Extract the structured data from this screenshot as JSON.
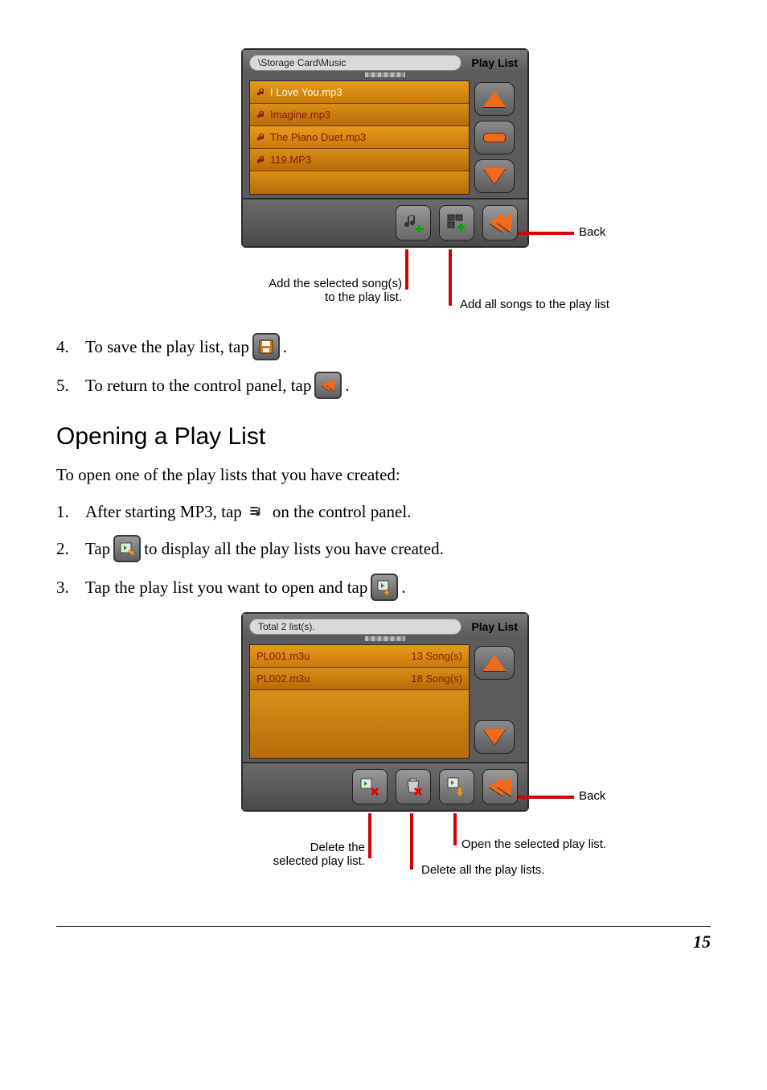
{
  "figure1": {
    "addr": "\\Storage Card\\Music",
    "title": "Play List",
    "songs": [
      {
        "name": "I Love You.mp3",
        "selected": true
      },
      {
        "name": "Imagine.mp3",
        "selected": false
      },
      {
        "name": "The Piano Duet.mp3",
        "selected": false
      },
      {
        "name": "119.MP3",
        "selected": false
      }
    ],
    "callouts": {
      "back": "Back",
      "add_selected_l1": "Add the selected song(s)",
      "add_selected_l2": "to the play list.",
      "add_all": "Add all songs to the play list"
    }
  },
  "step4": {
    "num": "4.",
    "pre": "To save the play list, tap",
    "post": "."
  },
  "step5": {
    "num": "5.",
    "pre": "To return to the control panel, tap",
    "post": "."
  },
  "heading": "Opening a Play List",
  "intro": "To open one of the play lists that you have created:",
  "ostep1": {
    "num": "1.",
    "pre": "After starting MP3, tap",
    "post": " on the control panel."
  },
  "ostep2": {
    "num": "2.",
    "pre": "Tap",
    "post": " to display all the play lists you have created."
  },
  "ostep3": {
    "num": "3.",
    "pre": "Tap the play list you want to open and tap",
    "post": "."
  },
  "figure2": {
    "addr": "Total 2 list(s).",
    "title": "Play List",
    "lists": [
      {
        "name": "PL001.m3u",
        "count": "13 Song(s)"
      },
      {
        "name": "PL002.m3u",
        "count": "18 Song(s)"
      }
    ],
    "callouts": {
      "back": "Back",
      "delete_sel_l1": "Delete the",
      "delete_sel_l2": "selected play list.",
      "open_sel": "Open the selected play list.",
      "delete_all": "Delete all the play lists."
    }
  },
  "page_number": "15"
}
